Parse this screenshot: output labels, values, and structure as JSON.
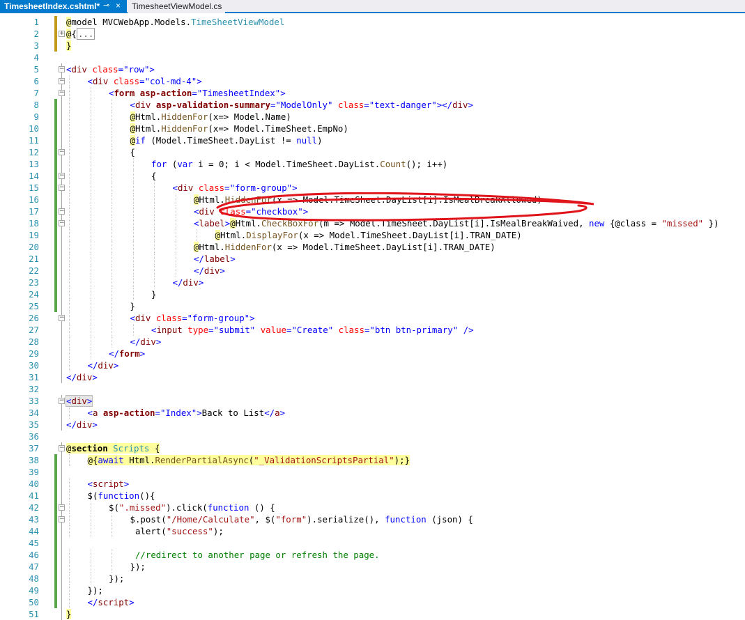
{
  "tabs": [
    {
      "label": "TimesheetIndex.cshtml*",
      "active": true
    },
    {
      "label": "TimesheetViewModel.cs",
      "active": false
    }
  ],
  "tab_icons": {
    "pin": "⊸",
    "close": "×"
  },
  "colors": {
    "accent": "#007acc",
    "annotation": "#e0151b",
    "line_number": "#2b91af",
    "saved_change": "#57a64a",
    "unsaved_change": "#c19a1a"
  },
  "editor": {
    "lines": [
      {
        "n": "1",
        "indent": 0,
        "html": "<span class=\"r\">@</span>model MVCWebApp.Models.<span class=\"ty\">TimeSheetViewModel</span>"
      },
      {
        "n": "2",
        "indent": 0,
        "html": "<span class=\"r\">@</span>{<span class=\"coll\">...</span>"
      },
      {
        "n": "3",
        "indent": 0,
        "html": "<span class=\"r\">}</span>"
      },
      {
        "n": "4",
        "indent": 0,
        "html": ""
      },
      {
        "n": "5",
        "indent": 0,
        "html": "<span class=\"v\">&lt;</span><span class=\"t\">div</span> <span class=\"a\">class</span><span class=\"v\">=\"row\"&gt;</span>"
      },
      {
        "n": "6",
        "indent": 1,
        "html": "<span class=\"v\">&lt;</span><span class=\"t\">div</span> <span class=\"a\">class</span><span class=\"v\">=\"col-md-4\"&gt;</span>"
      },
      {
        "n": "7",
        "indent": 2,
        "html": "<span class=\"v\">&lt;</span><span class=\"t\"><b>form</b></span> <span class=\"t\"><b>asp-action</b></span><span class=\"v\">=\"TimesheetIndex\"&gt;</span>"
      },
      {
        "n": "8",
        "indent": 3,
        "html": "<span class=\"v\">&lt;</span><span class=\"t\">div</span> <span class=\"t\"><b>asp-validation-summary</b></span><span class=\"v\">=\"ModelOnly\"</span> <span class=\"a\">class</span><span class=\"v\">=\"text-danger\"&gt;&lt;/</span><span class=\"t\">div</span><span class=\"v\">&gt;</span>"
      },
      {
        "n": "9",
        "indent": 3,
        "html": "<span class=\"r\">@</span>Html.<span class=\"m\">HiddenFor</span>(x=&gt; Model.Name)"
      },
      {
        "n": "10",
        "indent": 3,
        "html": "<span class=\"r\">@</span>Html.<span class=\"m\">HiddenFor</span>(x=&gt; Model.TimeSheet.EmpNo)"
      },
      {
        "n": "11",
        "indent": 3,
        "html": "<span class=\"r\">@</span><span class=\"k\">if</span> (Model.TimeSheet.DayList != <span class=\"k\">null</span>)"
      },
      {
        "n": "12",
        "indent": 3,
        "html": "{"
      },
      {
        "n": "13",
        "indent": 4,
        "html": "<span class=\"k\">for</span> (<span class=\"k\">var</span> i = 0; i &lt; Model.TimeSheet.DayList.<span class=\"m\">Count</span>(); i++)"
      },
      {
        "n": "14",
        "indent": 4,
        "html": "{"
      },
      {
        "n": "15",
        "indent": 5,
        "html": "<span class=\"v\">&lt;</span><span class=\"t\">div</span> <span class=\"a\">class</span><span class=\"v\">=\"form-group\"&gt;</span>"
      },
      {
        "n": "16",
        "indent": 6,
        "html": "<span class=\"r\">@</span>Html.<span class=\"m\">HiddenFor</span>(x =&gt; Model.TimeSheet.DayList[i].IsMealBreakAllowed)"
      },
      {
        "n": "17",
        "indent": 6,
        "html": "<span class=\"v\">&lt;</span><span class=\"t\">div</span> <span class=\"a\">class</span><span class=\"v\">=\"checkbox\"&gt;</span>"
      },
      {
        "n": "18",
        "indent": 6,
        "html": "<span class=\"v\">&lt;</span><span class=\"t\">label</span><span class=\"v\">&gt;</span><span class=\"r\">@</span>Html.<span class=\"m\">CheckBoxFor</span>(m =&gt; Model.TimeSheet.DayList[i].IsMealBreakWaived, <span class=\"k\">new</span> {@class = <span class=\"s\">\"missed\"</span> })"
      },
      {
        "n": "19",
        "indent": 7,
        "html": "<span class=\"r\">@</span>Html.<span class=\"m\">DisplayFor</span>(x =&gt; Model.TimeSheet.DayList[i].TRAN_DATE)"
      },
      {
        "n": "20",
        "indent": 6,
        "html": "<span class=\"r\">@</span>Html.<span class=\"m\">HiddenFor</span>(x =&gt; Model.TimeSheet.DayList[i].TRAN_DATE)"
      },
      {
        "n": "21",
        "indent": 6,
        "html": "<span class=\"v\">&lt;/</span><span class=\"t\">label</span><span class=\"v\">&gt;</span>"
      },
      {
        "n": "22",
        "indent": 6,
        "html": "<span class=\"v\">&lt;/</span><span class=\"t\">div</span><span class=\"v\">&gt;</span>"
      },
      {
        "n": "23",
        "indent": 5,
        "html": "<span class=\"v\">&lt;/</span><span class=\"t\">div</span><span class=\"v\">&gt;</span>"
      },
      {
        "n": "24",
        "indent": 4,
        "html": "}"
      },
      {
        "n": "25",
        "indent": 3,
        "html": "}"
      },
      {
        "n": "26",
        "indent": 3,
        "html": "<span class=\"v\">&lt;</span><span class=\"t\">div</span> <span class=\"a\">class</span><span class=\"v\">=\"form-group\"&gt;</span>"
      },
      {
        "n": "27",
        "indent": 4,
        "html": "<span class=\"v\">&lt;</span><span class=\"t\">input</span> <span class=\"a\">type</span><span class=\"v\">=\"submit\"</span> <span class=\"a\">value</span><span class=\"v\">=\"Create\"</span> <span class=\"a\">class</span><span class=\"v\">=\"btn btn-primary\"</span> <span class=\"v\">/&gt;</span>"
      },
      {
        "n": "28",
        "indent": 3,
        "html": "<span class=\"v\">&lt;/</span><span class=\"t\">div</span><span class=\"v\">&gt;</span>"
      },
      {
        "n": "29",
        "indent": 2,
        "html": "<span class=\"v\">&lt;/</span><span class=\"t\"><b>form</b></span><span class=\"v\">&gt;</span>"
      },
      {
        "n": "30",
        "indent": 1,
        "html": "<span class=\"v\">&lt;/</span><span class=\"t\">div</span><span class=\"v\">&gt;</span>"
      },
      {
        "n": "31",
        "indent": 0,
        "html": "<span class=\"v\">&lt;/</span><span class=\"t\">div</span><span class=\"v\">&gt;</span>"
      },
      {
        "n": "32",
        "indent": 0,
        "html": ""
      },
      {
        "n": "33",
        "indent": 0,
        "html": "<span class=\"hl\"><span class=\"v\">&lt;</span><span class=\"t\">div</span><span class=\"v\">&gt;</span></span>"
      },
      {
        "n": "34",
        "indent": 1,
        "html": "<span class=\"v\">&lt;</span><span class=\"t\">a</span> <span class=\"t\"><b>asp-action</b></span><span class=\"v\">=\"Index\"&gt;</span>Back to List<span class=\"v\">&lt;/</span><span class=\"t\">a</span><span class=\"v\">&gt;</span>"
      },
      {
        "n": "35",
        "indent": 0,
        "html": "<span class=\"v\">&lt;/</span><span class=\"t\">div</span><span class=\"v\">&gt;</span>"
      },
      {
        "n": "36",
        "indent": 0,
        "html": ""
      },
      {
        "n": "37",
        "indent": 0,
        "html": "<span class=\"r\">@</span><span class=\"r\"><b>section</b></span><span class=\"r\"> </span><span class=\"r\"><span class=\"ty\">Scripts</span></span><span class=\"r\"> {</span>"
      },
      {
        "n": "38",
        "indent": 1,
        "html": "<span class=\"r\">@{</span><span class=\"r\"><span class=\"k\">await</span></span><span class=\"r\"> Html.<span class=\"m\">RenderPartialAsync</span>(<span class=\"s\">\"_ValidationScriptsPartial\"</span>);}</span>"
      },
      {
        "n": "39",
        "indent": 0,
        "html": ""
      },
      {
        "n": "40",
        "indent": 1,
        "html": "<span class=\"v\">&lt;</span><span class=\"t\">script</span><span class=\"v\">&gt;</span>"
      },
      {
        "n": "41",
        "indent": 1,
        "html": "$(<span class=\"k\">function</span>(){"
      },
      {
        "n": "42",
        "indent": 2,
        "html": "$(<span class=\"s\">\".missed\"</span>).click(<span class=\"k\">function</span> () {"
      },
      {
        "n": "43",
        "indent": 3,
        "html": "$.post(<span class=\"s\">\"/Home/Calculate\"</span>, $(<span class=\"s\">\"form\"</span>).serialize(), <span class=\"k\">function</span> (json) {"
      },
      {
        "n": "44",
        "indent": 3,
        "html": " alert(<span class=\"s\">\"success\"</span>);"
      },
      {
        "n": "45",
        "indent": 0,
        "html": ""
      },
      {
        "n": "46",
        "indent": 3,
        "html": " <span class=\"c\">//redirect to another page or refresh the page.</span>"
      },
      {
        "n": "47",
        "indent": 3,
        "html": "});"
      },
      {
        "n": "48",
        "indent": 2,
        "html": "});"
      },
      {
        "n": "49",
        "indent": 1,
        "html": "});"
      },
      {
        "n": "50",
        "indent": 1,
        "html": "<span class=\"v\">&lt;/</span><span class=\"t\">script</span><span class=\"v\">&gt;</span>"
      },
      {
        "n": "51",
        "indent": 0,
        "html": "<span class=\"r\">}</span>"
      }
    ]
  }
}
